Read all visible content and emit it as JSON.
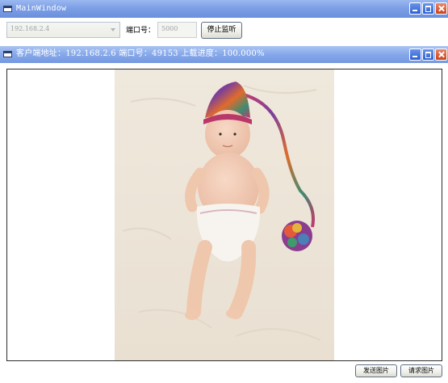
{
  "main_window": {
    "title": "MainWindow"
  },
  "connection": {
    "ip_value": "192.168.2.4",
    "port_label": "端口号：",
    "port_value": "5000",
    "stop_listen_button": "停止监听"
  },
  "client_window": {
    "title": "客户端地址：192.168.2.6 端口号：49153 上载进度：100.000%",
    "upload_progress": 1.0
  },
  "actions": {
    "send_image_button": "发送图片",
    "request_image_button": "请求图片"
  },
  "colors": {
    "title_bar": "#7d9fe6",
    "photo_background": "#eee6da",
    "border": "#2c2c2c"
  }
}
